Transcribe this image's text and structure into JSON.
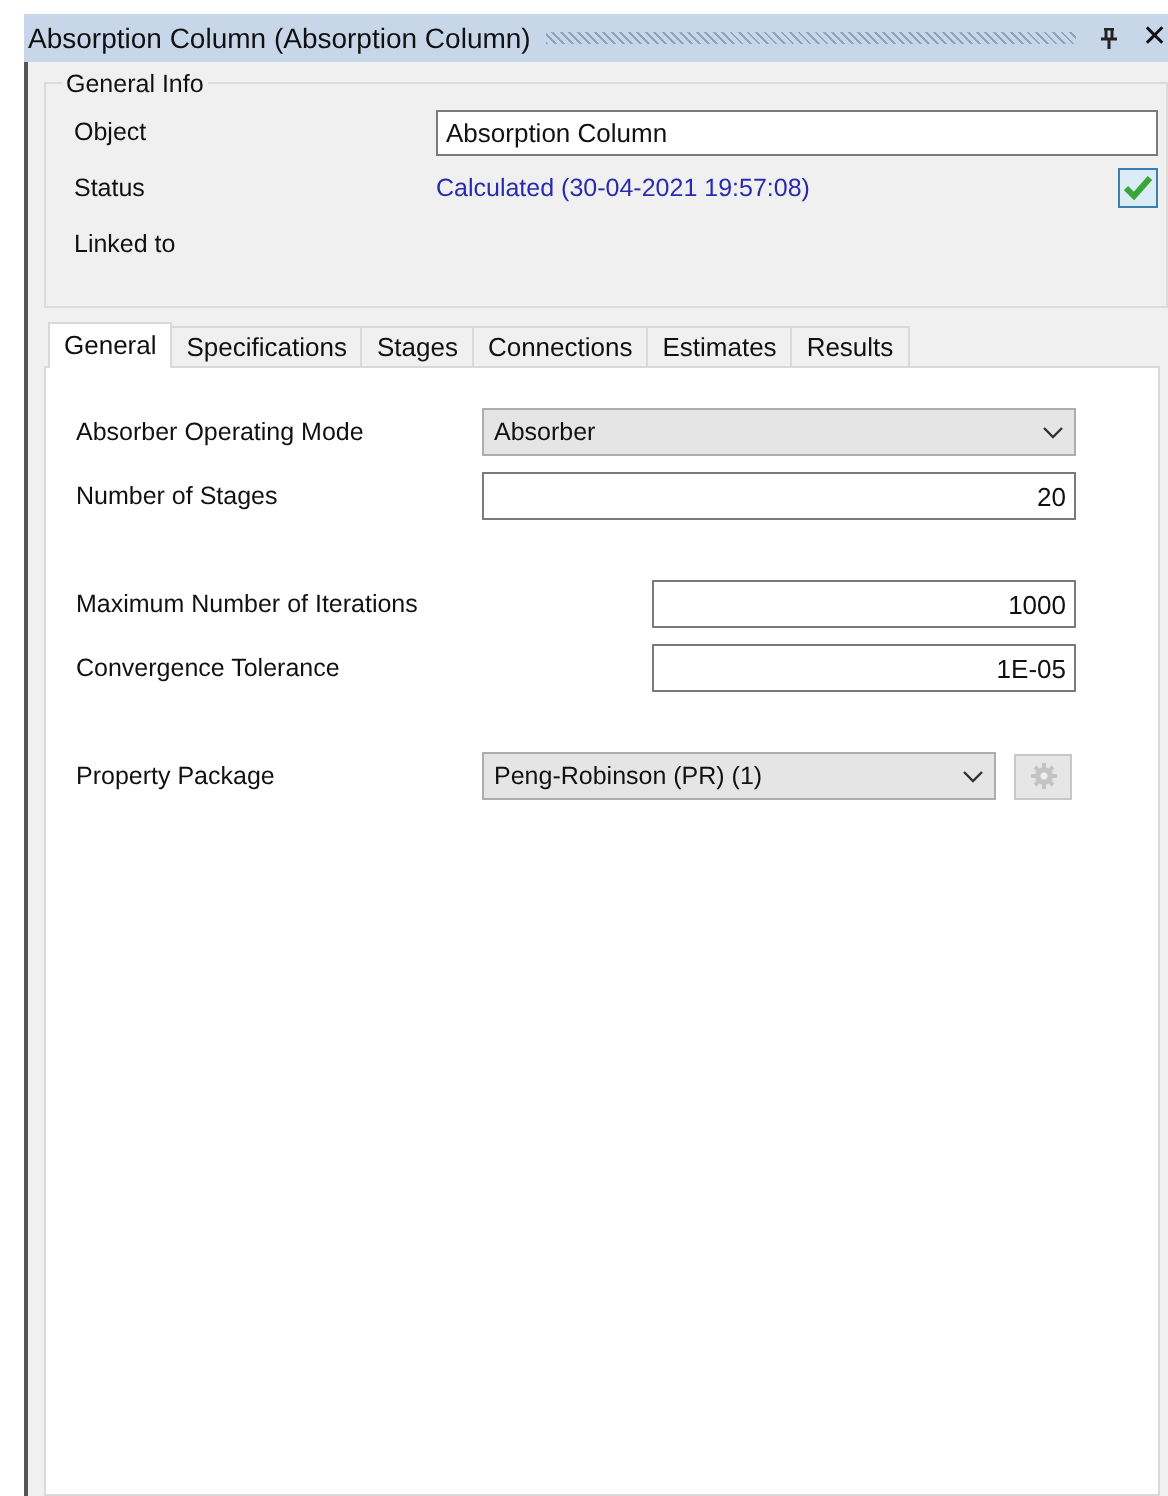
{
  "window": {
    "title": "Absorption Column (Absorption Column)",
    "close": "✕"
  },
  "general_info": {
    "title": "General Info",
    "object": {
      "label": "Object",
      "value": "Absorption Column"
    },
    "status": {
      "label": "Status",
      "value": "Calculated (30-04-2021 19:57:08)",
      "ok": true
    },
    "linked_to": {
      "label": "Linked to"
    }
  },
  "tabs": [
    {
      "label": "General",
      "selected": true
    },
    {
      "label": "Specifications",
      "selected": false
    },
    {
      "label": "Stages",
      "selected": false
    },
    {
      "label": "Connections",
      "selected": false
    },
    {
      "label": "Estimates",
      "selected": false
    },
    {
      "label": "Results",
      "selected": false
    }
  ],
  "field_groups": [
    [
      {
        "label": "Absorber Operating Mode",
        "value": "Absorber",
        "kind": "dropdown"
      },
      {
        "label": "Number of Stages",
        "value": "20",
        "kind": "text"
      }
    ],
    [
      {
        "label": "Maximum Number of Iterations",
        "value": "1000",
        "kind": "text"
      },
      {
        "label": "Convergence Tolerance",
        "value": "1E-05",
        "kind": "text"
      }
    ],
    [
      {
        "label": "Property Package",
        "value": "Peng-Robinson (PR) (1)",
        "kind": "dropdown",
        "settings_disabled": true
      }
    ]
  ]
}
